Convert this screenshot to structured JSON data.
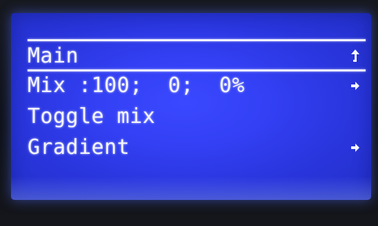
{
  "menu": {
    "header": {
      "label": "Main",
      "icon": "back-arrow-icon"
    },
    "items": [
      {
        "label": "Mix :100;  0;  0%",
        "icon": "right-arrow-icon"
      },
      {
        "label": "Toggle mix",
        "icon": ""
      },
      {
        "label": "Gradient",
        "icon": "right-arrow-icon"
      }
    ]
  },
  "colors": {
    "screen_background": "#3340f4",
    "text": "#f4f6ff",
    "bezel": "#0f1117"
  }
}
